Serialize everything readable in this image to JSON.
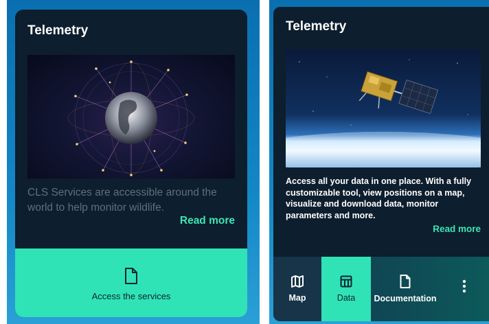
{
  "left_card": {
    "title": "Telemetry",
    "description": "CLS Services are accessible around the world to help monitor wildlife.",
    "read_more": "Read more",
    "access_button": "Access the services"
  },
  "right_card": {
    "title": "Telemetry",
    "description": "Access all your data in one place. With a fully customizable tool, view positions on a map, visualize and download data, monitor parameters and more.",
    "read_more": "Read more",
    "tabs": [
      {
        "label": "Map",
        "icon": "map-icon"
      },
      {
        "label": "Data",
        "icon": "table-icon",
        "active": true
      },
      {
        "label": "Documentation",
        "icon": "document-icon"
      }
    ],
    "more_icon": "more-vertical-icon"
  },
  "colors": {
    "background": "#1487c6",
    "card": "#0d1e2e",
    "accent": "#30e3b6",
    "read_more": "#3ee6b4"
  }
}
